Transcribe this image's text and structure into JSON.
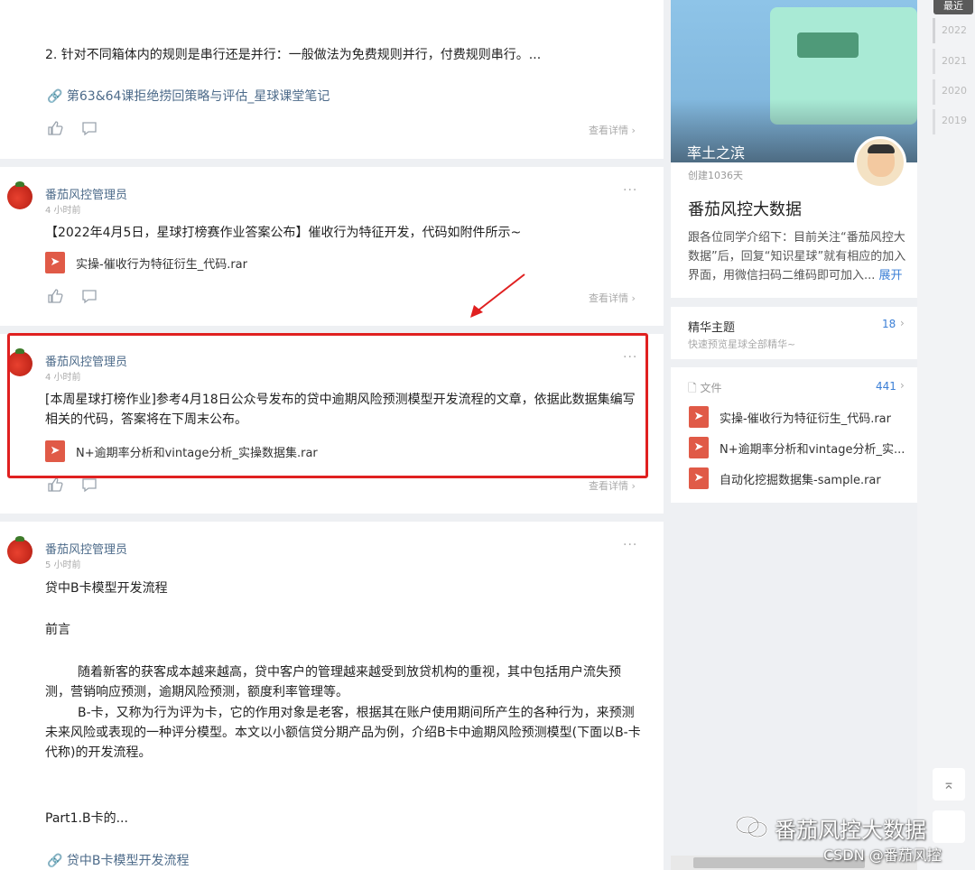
{
  "posts": [
    {
      "text": "2. 针对不同箱体内的规则是串行还是并行：一般做法为免费规则并行，付费规则串行。...",
      "link": "第63&64课拒绝捞回策略与评估_星球课堂笔记",
      "detail": "查看详情"
    },
    {
      "author": "番茄风控管理员",
      "time": "4 小时前",
      "more": "···",
      "text": "【2022年4月5日，星球打榜赛作业答案公布】催收行为特征开发，代码如附件所示~",
      "file": "实操-催收行为特征衍生_代码.rar",
      "detail": "查看详情"
    },
    {
      "author": "番茄风控管理员",
      "time": "4 小时前",
      "more": "···",
      "text": "[本周星球打榜作业]参考4月18日公众号发布的贷中逾期风险预测模型开发流程的文章，依据此数据集编写相关的代码，答案将在下周末公布。",
      "file": "N+逾期率分析和vintage分析_实操数据集.rar",
      "detail": "查看详情"
    },
    {
      "author": "番茄风控管理员",
      "time": "5 小时前",
      "more": "···",
      "title": "贷中B卡模型开发流程",
      "preface": "前言",
      "para1": "随着新客的获客成本越来越高，贷中客户的管理越来越受到放贷机构的重视，其中包括用户流失预测，营销响应预测，逾期风险预测，额度利率管理等。",
      "para2": "B-卡，又称为行为评为卡，它的作用对象是老客，根据其在账户使用期间所产生的各种行为，来预测未来风险或表现的一种评分模型。本文以小额信贷分期产品为例，介绍B卡中逾期风险预测模型(下面以B-卡代称)的开发流程。",
      "part": "Part1.B卡的...",
      "link": "贷中B卡模型开发流程"
    }
  ],
  "group": {
    "banner_title": "率土之滨",
    "created": "创建1036天",
    "name": "番茄风控大数据",
    "description": "跟各位同学介绍下：目前关注“番茄风控大数据”后，回复“知识星球”就有相应的加入界面，用微信扫码二维码即可加入...",
    "expand": "展开"
  },
  "featured": {
    "title": "精华主题",
    "count": "18",
    "subtitle": "快速预览星球全部精华~"
  },
  "files": {
    "title": "文件",
    "count": "441",
    "items": [
      "实操-催收行为特征衍生_代码.rar",
      "N+逾期率分析和vintage分析_实...",
      "自动化挖掘数据集-sample.rar"
    ]
  },
  "timeline": {
    "latest": "最近",
    "years": [
      "2022",
      "2021",
      "2020",
      "2019"
    ]
  },
  "watermark": {
    "wechat": "番茄风控大数据",
    "csdn": "CSDN @番茄风控"
  },
  "colors": {
    "highlight": "#e02020",
    "link": "#4d6b8a",
    "accent": "#3b7fd6",
    "file_icon": "#e05a47"
  },
  "icons": [
    "link-icon",
    "like-icon",
    "comment-icon",
    "pdf-file-icon",
    "chevron-right-icon",
    "scroll-top-icon",
    "wechat-icon",
    "document-icon"
  ]
}
